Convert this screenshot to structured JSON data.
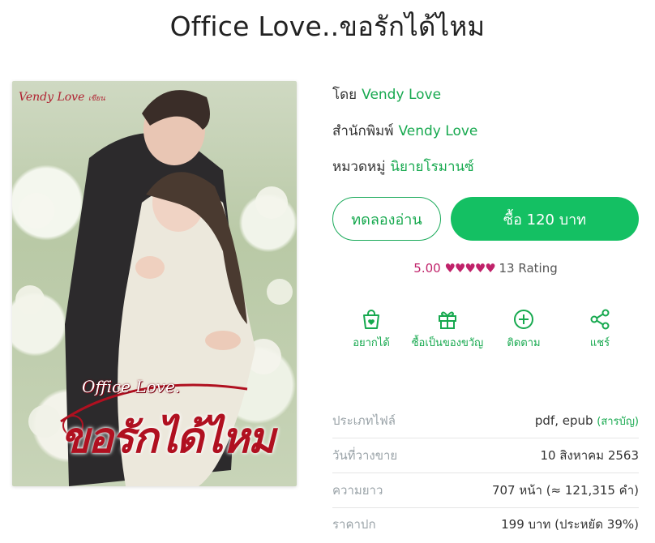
{
  "book": {
    "title": "Office Love..ขอรักได้ไหม",
    "cover": {
      "author_text": "Vendy Love",
      "author_suffix": "เขียน",
      "title_en": "Office Love.",
      "title_th": "ขอรักได้ไหม"
    }
  },
  "meta": {
    "author_label": "โดย",
    "author": "Vendy Love",
    "publisher_label": "สำนักพิมพ์",
    "publisher": "Vendy Love",
    "category_label": "หมวดหมู่",
    "category": "นิยายโรมานซ์"
  },
  "buttons": {
    "try_label": "ทดลองอ่าน",
    "buy_label": "ซื้อ 120 บาท"
  },
  "rating": {
    "score": "5.00",
    "hearts": "♥♥♥♥♥",
    "count": "13 Rating",
    "color": "#c0226a"
  },
  "actions": [
    {
      "label": "อยากได้",
      "icon": "wishlist-bag-icon"
    },
    {
      "label": "ซื้อเป็นของขวัญ",
      "icon": "gift-icon"
    },
    {
      "label": "ติดตาม",
      "icon": "plus-circle-icon"
    },
    {
      "label": "แชร์",
      "icon": "share-icon"
    }
  ],
  "info": {
    "filetype_label": "ประเภทไฟล์",
    "filetype_value": "pdf, epub",
    "filetype_link": "(สารบัญ)",
    "release_label": "วันที่วางขาย",
    "release_value": "10 สิงหาคม 2563",
    "length_label": "ความยาว",
    "length_value": "707 หน้า (≈ 121,315 คำ)",
    "price_label": "ราคาปก",
    "price_value": "199 บาท (ประหยัด 39%)"
  },
  "colors": {
    "accent": "#17a94f",
    "buy_button": "#14c063",
    "heart": "#c0226a"
  }
}
